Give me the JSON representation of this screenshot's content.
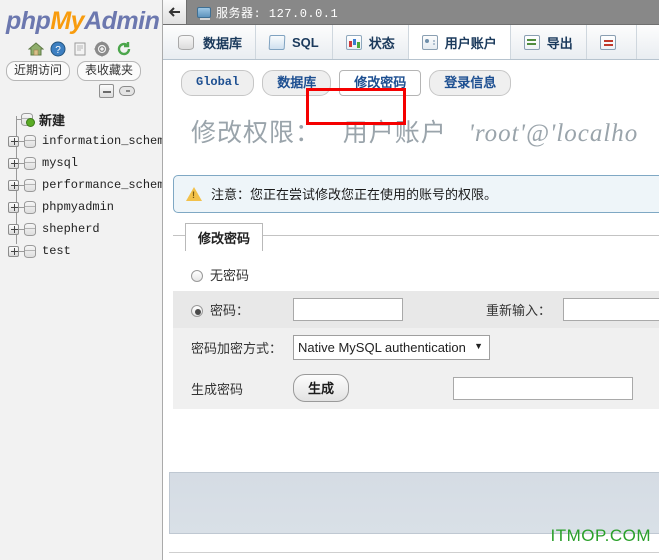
{
  "sidebar": {
    "logo": {
      "php": "php",
      "my": "My",
      "admin": "Admin"
    },
    "icons": [
      {
        "name": "home-icon",
        "glyph": "⌂"
      },
      {
        "name": "help-icon",
        "glyph": "?"
      },
      {
        "name": "documentation-icon",
        "glyph": "☰"
      },
      {
        "name": "settings-gear-icon",
        "glyph": "⚙"
      },
      {
        "name": "reload-icon",
        "glyph": "↻"
      }
    ],
    "quick_links": [
      {
        "label": "近期访问"
      },
      {
        "label": "表收藏夹"
      }
    ],
    "collapse": {
      "collapse_label": "-",
      "link_label": ""
    },
    "new_item": {
      "label": "新建"
    },
    "databases": [
      {
        "label": "information_schema"
      },
      {
        "label": "mysql"
      },
      {
        "label": "performance_schema"
      },
      {
        "label": "phpmyadmin"
      },
      {
        "label": "shepherd"
      },
      {
        "label": "test"
      }
    ]
  },
  "server_bar": {
    "back_label": "←",
    "title": "服务器: 127.0.0.1"
  },
  "nav_tabs": [
    {
      "label": "数据库",
      "icon": "database-icon",
      "active": false
    },
    {
      "label": "SQL",
      "icon": "sql-icon",
      "active": false
    },
    {
      "label": "状态",
      "icon": "status-icon",
      "active": false
    },
    {
      "label": "用户账户",
      "icon": "user-accounts-icon",
      "active": true
    },
    {
      "label": "导出",
      "icon": "export-icon",
      "active": false
    },
    {
      "label": "",
      "icon": "import-icon",
      "active": false
    }
  ],
  "sub_tabs": [
    {
      "label": "Global",
      "active": false,
      "mono": true
    },
    {
      "label": "数据库",
      "active": false,
      "mono": false
    },
    {
      "label": "修改密码",
      "active": true,
      "mono": false
    },
    {
      "label": "登录信息",
      "active": false,
      "mono": false
    }
  ],
  "highlight": {
    "color": "#f50000"
  },
  "heading": {
    "prefix": "修改权限：",
    "subject": "用户账户",
    "account": "'root'@'localho"
  },
  "notice": {
    "icon": "warning-icon",
    "text": "注意：您正在尝试修改您正在使用的账号的权限。"
  },
  "password_form": {
    "legend": "修改密码",
    "no_password": {
      "label": "无密码",
      "checked": false
    },
    "password": {
      "label": "密码：",
      "checked": true,
      "value": ""
    },
    "reenter": {
      "label": "重新输入：",
      "value": ""
    },
    "hashing": {
      "label": "密码加密方式：",
      "selected": "Native MySQL authentication",
      "options": [
        "Native MySQL authentication"
      ]
    },
    "generate": {
      "label": "生成密码",
      "button": "生成",
      "value": ""
    }
  },
  "watermark": {
    "text": "ITMOP.COM",
    "color": "#2aa02a"
  }
}
